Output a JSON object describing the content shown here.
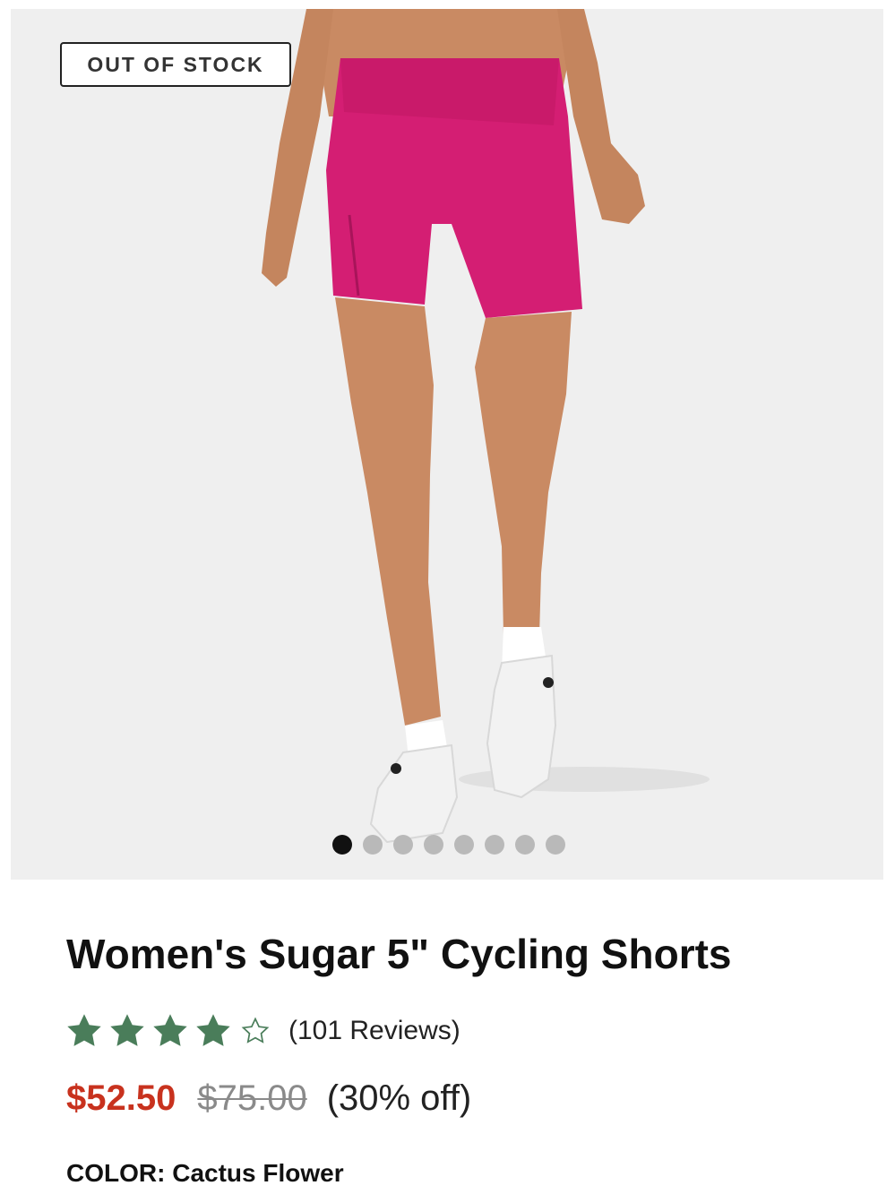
{
  "product_image": {
    "badge": "OUT OF STOCK",
    "carousel": {
      "total": 8,
      "active_index": 0
    }
  },
  "product": {
    "title": "Women's Sugar 5\" Cycling Shorts",
    "rating": {
      "value": 4,
      "max": 5,
      "reviews_text": "(101 Reviews)"
    },
    "price": {
      "sale": "$52.50",
      "original": "$75.00",
      "discount": "(30% off)"
    },
    "color": {
      "label": "COLOR:",
      "value": "Cactus Flower"
    }
  },
  "colors": {
    "sale_price": "#c8321e",
    "star": "#4a7d5a",
    "shorts": "#d41e73"
  }
}
